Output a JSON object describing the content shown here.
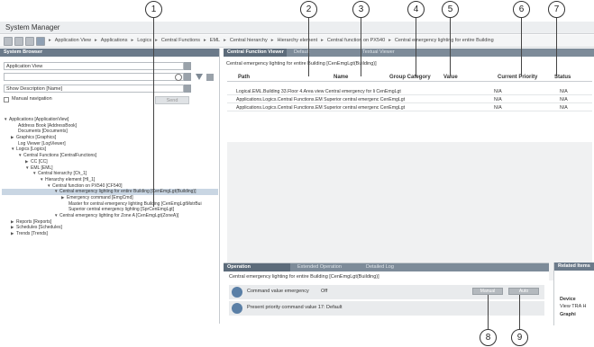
{
  "app": {
    "title": "System Manager"
  },
  "breadcrumb": [
    "Application View",
    "Applications",
    "Logics",
    "Central Functions",
    "EML",
    "Central hierarchy",
    "Hierarchy element",
    "Central function on PX540",
    "Central emergency lighting for entire Building"
  ],
  "system_browser": {
    "title": "System Browser",
    "view_select": "Application View",
    "search_value": "",
    "description_select": "Show Description [Name]",
    "manual_navigation_label": "Manual navigation",
    "send_label": "Send",
    "tree": [
      {
        "label": "Applications [ApplicationView]",
        "toggle": "▼"
      },
      {
        "label": "Address Book [AddressBook]",
        "toggle": ""
      },
      {
        "label": "Documents [Documents]",
        "toggle": ""
      },
      {
        "label": "Graphics [Graphics]",
        "toggle": "▶"
      },
      {
        "label": "Log Viewer [LogViewer]",
        "toggle": ""
      },
      {
        "label": "Logics [Logics]",
        "toggle": "▼"
      },
      {
        "label": "Central Functions [CentralFunctions]",
        "toggle": "▼"
      },
      {
        "label": "CC [CC]",
        "toggle": "▶"
      },
      {
        "label": "EML [EML]",
        "toggle": "▼"
      },
      {
        "label": "Central hierarchy [Ch_1]",
        "toggle": "▼"
      },
      {
        "label": "Hierarchy element [HI_1]",
        "toggle": "▼"
      },
      {
        "label": "Central function on PX540 [CF540]",
        "toggle": "▼"
      },
      {
        "label": "Central emergency lighting for entire Building [CenEmgLgt(Building)]",
        "toggle": "▼"
      },
      {
        "label": "Emergency command [EmgCmd]",
        "toggle": "▶"
      },
      {
        "label": "Master for central emergency lighting Building [CenEmgLgtMstrBui",
        "toggle": ""
      },
      {
        "label": "Superior central emergency lighting [SprCenEmgLgt]",
        "toggle": ""
      },
      {
        "label": "Central emergency lighting for Zone A [CenEmgLgt(ZoneA)]",
        "toggle": "▼"
      },
      {
        "label": "Reports [Reports]",
        "toggle": "▶"
      },
      {
        "label": "Schedules [Schedules]",
        "toggle": "▶"
      },
      {
        "label": "Trends [Trends]",
        "toggle": "▶"
      }
    ]
  },
  "center": {
    "tabs": [
      "Central Function Viewer",
      "Default",
      "Textual Viewer"
    ],
    "object_title": "Central emergency lighting for entire Building [CenEmgLgt(Building)]",
    "columns": [
      "Path",
      "Name",
      "Group Category",
      "Value",
      "Current Priority",
      "Status"
    ],
    "rows": [
      {
        "path": "Logical.EML.Building 33.Floor 4.Area view Central emergency for li CenEmgLgt",
        "name": "",
        "group": "",
        "value": "",
        "priority": "N/A",
        "status": "N/A"
      },
      {
        "path": "Applications.Logics.Central Functions.EM Superior central emergenc CenEmgLgt",
        "name": "",
        "group": "",
        "value": "",
        "priority": "N/A",
        "status": "N/A"
      },
      {
        "path": "Applications.Logics.Central Functions.EM Superior central emergenc CenEmgLgt",
        "name": "",
        "group": "",
        "value": "",
        "priority": "N/A",
        "status": "N/A"
      }
    ]
  },
  "operation": {
    "tabs": [
      "Operation",
      "Extended Operation",
      "Detailed Log"
    ],
    "object_title": "Central emergency lighting for entire Building [CenEmgLgt(Building)]",
    "command_label": "Command value emergency",
    "command_value": "Off",
    "manual_label": "Manual",
    "auto_label": "Auto",
    "priority_label": "Present priority command value 17: Default"
  },
  "related": {
    "title": "Related Items",
    "items": [
      "Device",
      "View TRA H",
      "Graphi"
    ]
  },
  "callouts": [
    "1",
    "2",
    "3",
    "4",
    "5",
    "6",
    "7",
    "8",
    "9"
  ]
}
